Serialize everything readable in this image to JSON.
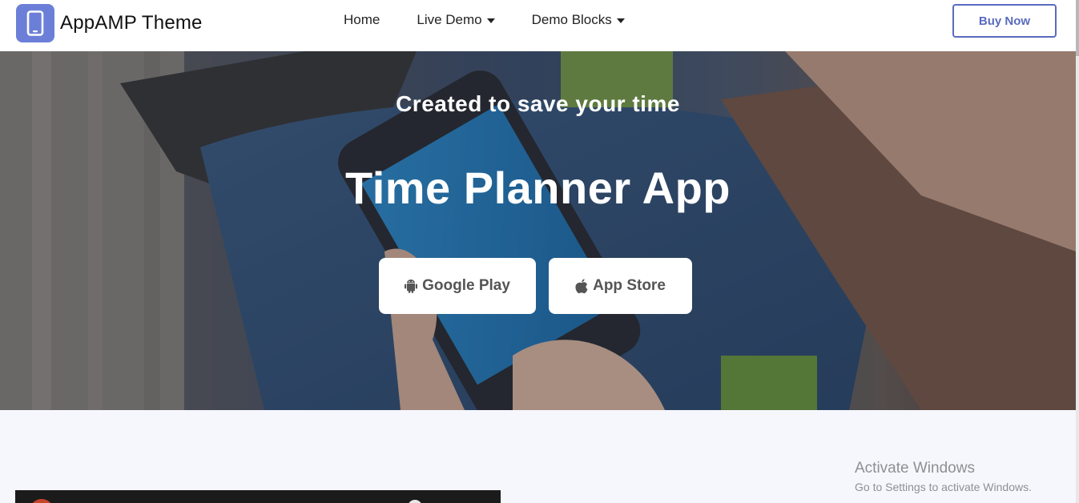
{
  "brand": {
    "title": "AppAMP Theme",
    "logo_icon": "smartphone-icon",
    "logo_color": "#6c7fd8"
  },
  "nav": {
    "items": [
      {
        "label": "Home",
        "has_dropdown": false
      },
      {
        "label": "Live Demo",
        "has_dropdown": true
      },
      {
        "label": "Demo Blocks",
        "has_dropdown": true
      }
    ],
    "buy_label": "Buy Now",
    "accent_color": "#5a6bbf"
  },
  "hero": {
    "subtitle": "Created to save your time",
    "title": "Time Planner App",
    "buttons": [
      {
        "label": "Google Play",
        "icon": "android-icon"
      },
      {
        "label": "App Store",
        "icon": "apple-icon"
      }
    ]
  },
  "watermark": {
    "title": "Activate Windows",
    "subtitle": "Go to Settings to activate Windows."
  }
}
